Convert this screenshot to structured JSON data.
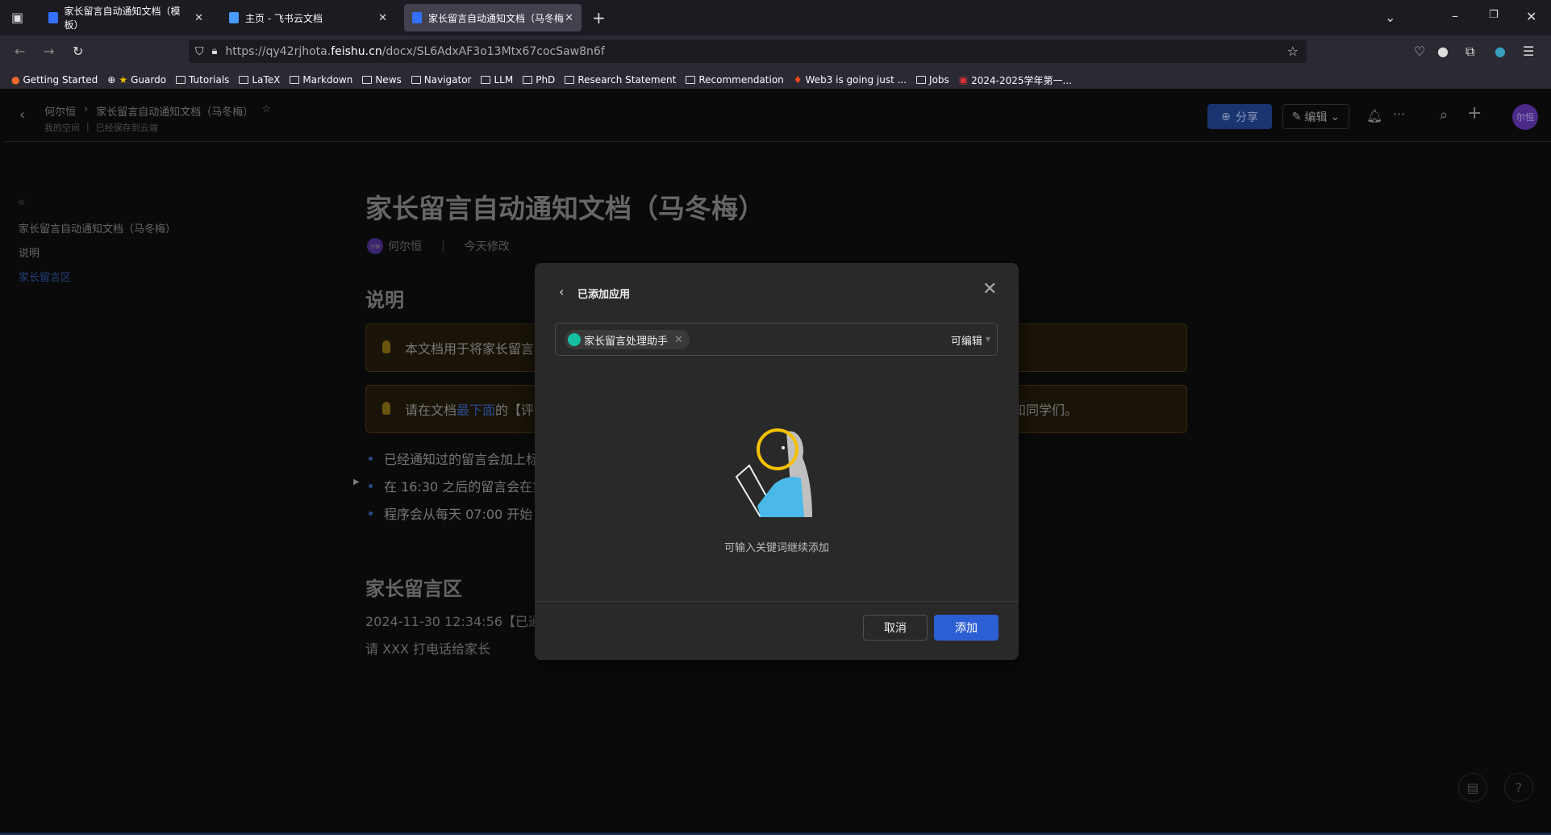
{
  "browser": {
    "tabs": [
      {
        "title": "家长留言自动通知文档（模板）"
      },
      {
        "title": "主页 - 飞书云文档"
      },
      {
        "title": "家长留言自动通知文档（马冬梅"
      }
    ],
    "url_prefix": "https://qy42rjhota.",
    "url_domain": "feishu.cn",
    "url_suffix": "/docx/SL6AdxAF3o13Mtx67cocSaw8n6f",
    "bookmarks": [
      "Getting Started",
      "Guardo",
      "Tutorials",
      "LaTeX",
      "Markdown",
      "News",
      "Navigator",
      "LLM",
      "PhD",
      "Research Statement",
      "Recommendation",
      "Web3 is going just ...",
      "Jobs",
      "2024-2025学年第一..."
    ]
  },
  "header": {
    "breadcrumb_owner": "何尔恒",
    "breadcrumb_doc": "家长留言自动通知文档（马冬梅）",
    "space": "我的空间",
    "save_status": "已经保存到云端",
    "share": "分享",
    "edit": "编辑",
    "avatar": "尔恒"
  },
  "sidebar": {
    "items": [
      {
        "label": "家长留言自动通知文档（马冬梅）"
      },
      {
        "label": "说明"
      },
      {
        "label": "家长留言区",
        "active": true
      }
    ]
  },
  "doc": {
    "title": "家长留言自动通知文档（马冬梅）",
    "author": "何尔恒",
    "author_avatar": "尔恒",
    "modified": "今天修改",
    "h_intro": "说明",
    "callout1": "本文档用于将家长留言",
    "callout2_a": "请在文档",
    "callout2_b": "最下面",
    "callout2_c": "的【评",
    "callout2_end": "知同学们。",
    "bullets": [
      "已经通知过的留言会加上标",
      "在 16:30 之后的留言会在第",
      "程序会从每天 07:00 开始，"
    ],
    "h_messages": "家长留言区",
    "line1": "2024-11-30 12:34:56【已通知",
    "line2": "请 XXX 打电话给家长"
  },
  "modal": {
    "title": "已添加应用",
    "tag": "家长留言处理助手",
    "permission": "可编辑",
    "hint": "可输入关键词继续添加",
    "cancel": "取消",
    "add": "添加"
  },
  "colors": {
    "primary": "#2d5fd4",
    "tag_icon": "#14c0a0",
    "link": "#2a4a90"
  }
}
